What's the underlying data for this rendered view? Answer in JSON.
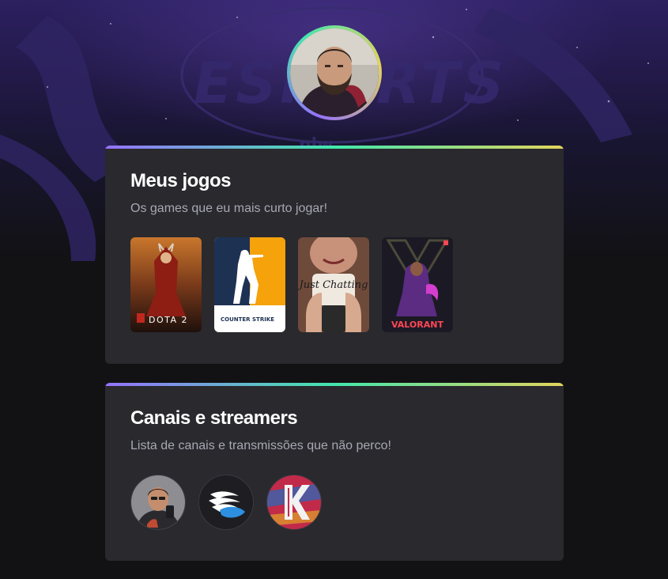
{
  "profile": {
    "avatar_icon": "user-avatar-photo",
    "background_art": "esports-nlw-logo"
  },
  "games_card": {
    "title": "Meus jogos",
    "subtitle": "Os games que eu mais curto jogar!",
    "games": [
      {
        "name": "DOTA 2"
      },
      {
        "name": "COUNTER STRIKE"
      },
      {
        "name": "Just Chatting"
      },
      {
        "name": "VALORANT"
      }
    ]
  },
  "channels_card": {
    "title": "Canais e streamers",
    "subtitle": "Lista de canais e transmissões que não perco!",
    "channels": [
      {
        "icon": "streamer-avatar-photo"
      },
      {
        "icon": "winged-logo-icon"
      },
      {
        "icon": "k-logo-icon"
      }
    ]
  },
  "colors": {
    "background": "#121214",
    "card": "#29292e",
    "gradient": [
      "#9572fc",
      "#43e7ad",
      "#e2d45c"
    ],
    "title": "#ffffff",
    "subtitle": "#a8a8b3"
  }
}
